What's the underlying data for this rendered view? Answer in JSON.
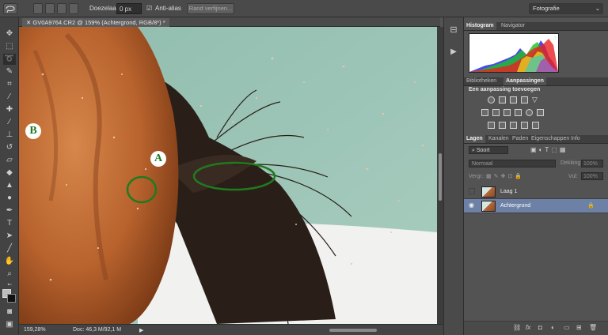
{
  "options_bar": {
    "feather_label": "Doezelaar:",
    "feather_value": "0 px",
    "antialias_label": "Anti-alias",
    "refine_edge_label": "Rand verfijnen...",
    "workspace_value": "Fotografie"
  },
  "document": {
    "tab_title": "GV0A9764.CR2 @ 159% (Achtergrond, RGB/8*) *",
    "zoom": "159,28%",
    "doc_info": "Doc: 46,3 M/92,1 M",
    "annotations": {
      "a_label": "A",
      "b_label": "B",
      "color": "#1f7a1f"
    }
  },
  "histogram_panel": {
    "tabs": [
      "Histogram",
      "Navigator"
    ]
  },
  "adjustments_panel": {
    "tabs": [
      "Bibliotheken",
      "Aanpassingen"
    ],
    "heading": "Een aanpassing toevoegen"
  },
  "layers_panel": {
    "tabs": [
      "Lagen",
      "Kanalen",
      "Paden",
      "Eigenschappen",
      "Info"
    ],
    "filter_value": "Soort",
    "blend_mode": "Normaal",
    "opacity_label": "Dekking:",
    "opacity_value": "100%",
    "lock_label": "Vergr.:",
    "fill_label": "Vul:",
    "fill_value": "100%",
    "layers": [
      {
        "name": "Laag 1",
        "selected": false
      },
      {
        "name": "Achtergrond",
        "selected": true
      }
    ],
    "footer_icons": [
      "link-icon",
      "fx-icon",
      "mask-icon",
      "adjustment-icon",
      "folder-icon",
      "new-layer-icon",
      "trash-icon"
    ]
  },
  "colors": {
    "panel_bg": "#535353",
    "selected_layer": "#6d80a6",
    "annotation_green": "#1f7a1f"
  }
}
